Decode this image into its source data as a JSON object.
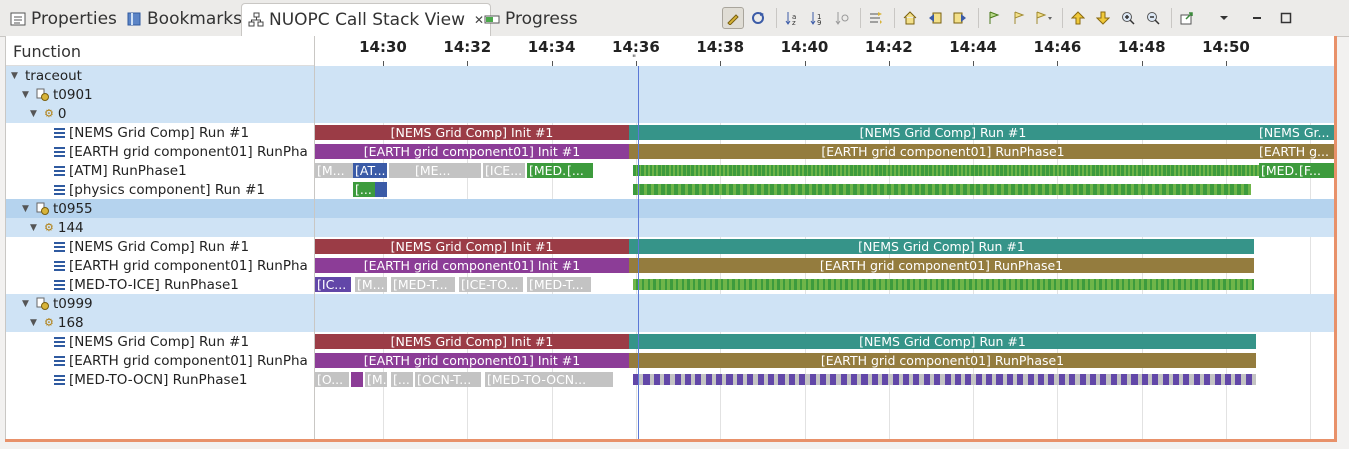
{
  "tabs": [
    {
      "label": "Properties",
      "icon": "properties-icon"
    },
    {
      "label": "Bookmarks",
      "icon": "bookmarks-icon"
    },
    {
      "label": "NUOPC Call Stack View",
      "icon": "call-stack-icon",
      "active": true,
      "closable": true
    },
    {
      "label": "Progress",
      "icon": "progress-icon"
    }
  ],
  "toolbar": [
    "pin-icon",
    "synchronize-icon",
    "sort-alpha-icon",
    "sort-numeric-icon",
    "sort-time-icon",
    "show-legend-icon",
    "home-icon",
    "previous-event-icon",
    "next-event-icon",
    "previous-marker-icon",
    "next-marker-icon",
    "marker-dropdown-icon",
    "previous-item-icon",
    "next-item-icon",
    "zoom-in-icon",
    "zoom-out-icon",
    "view-menu-icon",
    "minimize-icon",
    "maximize-icon"
  ],
  "tree": {
    "header": "Function",
    "rows": [
      {
        "label": "traceout",
        "type": "root",
        "hl": true
      },
      {
        "label": "t0901",
        "type": "thread",
        "hl": true
      },
      {
        "label": "0",
        "type": "pet",
        "hl": true
      },
      {
        "label": "[NEMS Grid Comp] Run #1",
        "type": "fn"
      },
      {
        "label": "[EARTH grid component01] RunPha",
        "type": "fn"
      },
      {
        "label": "[ATM] RunPhase1",
        "type": "fn"
      },
      {
        "label": "[physics component] Run #1",
        "type": "fn"
      },
      {
        "label": "t0955",
        "type": "thread",
        "hl": true,
        "sel": true
      },
      {
        "label": "144",
        "type": "pet",
        "hl": true
      },
      {
        "label": "[NEMS Grid Comp] Run #1",
        "type": "fn"
      },
      {
        "label": "[EARTH grid component01] RunPha",
        "type": "fn"
      },
      {
        "label": "[MED-TO-ICE] RunPhase1",
        "type": "fn"
      },
      {
        "label": "t0999",
        "type": "thread",
        "hl": true
      },
      {
        "label": "168",
        "type": "pet",
        "hl": true
      },
      {
        "label": "[NEMS Grid Comp] Run #1",
        "type": "fn"
      },
      {
        "label": "[EARTH grid component01] RunPha",
        "type": "fn"
      },
      {
        "label": "[MED-TO-OCN] RunPhase1",
        "type": "fn"
      }
    ]
  },
  "time_axis": {
    "ticks": [
      "14:30",
      "14:32",
      "14:34",
      "14:36",
      "14:38",
      "14:40",
      "14:42",
      "14:44",
      "14:46",
      "14:48",
      "14:50"
    ],
    "cursor_marker": "\""
  },
  "colors": {
    "nems_init": "#9b3c46",
    "nems_run": "#369489",
    "earth_init": "#8c3d97",
    "earth_run": "#947c3e",
    "green": "#3d9b3d",
    "blue": "#3b5ba7",
    "gray": "#c3c3c3",
    "purple": "#6247a8",
    "lightgreen": "#6fb549",
    "highlight": "#cfe3f5"
  },
  "tracks": {
    "3": [
      {
        "s": 0,
        "e": 314,
        "c": "nems_init",
        "t": "[NEMS Grid Comp] Init #1"
      },
      {
        "s": 314,
        "e": 942,
        "c": "nems_run",
        "t": "[NEMS Grid Comp] Run #1"
      },
      {
        "s": 942,
        "e": 1021,
        "c": "nems_run",
        "t": "[NEMS Gr...",
        "l": 1
      }
    ],
    "4": [
      {
        "s": 0,
        "e": 314,
        "c": "earth_init",
        "t": "[EARTH grid component01] Init #1"
      },
      {
        "s": 314,
        "e": 942,
        "c": "earth_run",
        "t": "[EARTH grid component01] RunPhase1"
      },
      {
        "s": 942,
        "e": 1021,
        "c": "earth_run",
        "t": "[EARTH g...",
        "l": 1
      }
    ],
    "5": [
      {
        "s": 0,
        "e": 38,
        "c": "gray",
        "t": "[M...",
        "l": 1
      },
      {
        "s": 38,
        "e": 72,
        "c": "blue",
        "t": "[AT...",
        "l": 1
      },
      {
        "s": 74,
        "e": 98,
        "c": "gray",
        "t": ""
      },
      {
        "s": 98,
        "e": 140,
        "c": "gray",
        "t": "[ME...",
        "l": 1
      },
      {
        "s": 140,
        "e": 166,
        "c": "gray",
        "t": ""
      },
      {
        "s": 168,
        "e": 210,
        "c": "gray",
        "t": "[ICE...",
        "l": 1
      },
      {
        "s": 212,
        "e": 250,
        "c": "green",
        "t": "[MED...",
        "l": 1
      },
      {
        "s": 250,
        "e": 278,
        "c": "green",
        "t": "[...",
        "l": 1
      },
      {
        "s": 944,
        "e": 982,
        "c": "green",
        "t": "[MED...",
        "l": 1
      },
      {
        "s": 982,
        "e": 1021,
        "c": "green",
        "t": "[F...",
        "l": 1
      }
    ],
    "6": [
      {
        "s": 38,
        "e": 60,
        "c": "green",
        "t": "[...",
        "l": 1
      },
      {
        "s": 60,
        "e": 72,
        "c": "blue",
        "t": ""
      }
    ],
    "9": [
      {
        "s": 0,
        "e": 314,
        "c": "nems_init",
        "t": "[NEMS Grid Comp] Init #1"
      },
      {
        "s": 314,
        "e": 939,
        "c": "nems_run",
        "t": "[NEMS Grid Comp] Run #1"
      }
    ],
    "10": [
      {
        "s": 0,
        "e": 314,
        "c": "earth_init",
        "t": "[EARTH grid component01] Init #1"
      },
      {
        "s": 314,
        "e": 939,
        "c": "earth_run",
        "t": "[EARTH grid component01] RunPhase1"
      }
    ],
    "11": [
      {
        "s": 0,
        "e": 36,
        "c": "purple",
        "t": "[IC...",
        "l": 1
      },
      {
        "s": 40,
        "e": 72,
        "c": "gray",
        "t": "[M...",
        "l": 1
      },
      {
        "s": 76,
        "e": 140,
        "c": "gray",
        "t": "[MED-T...",
        "l": 1
      },
      {
        "s": 144,
        "e": 208,
        "c": "gray",
        "t": "[ICE-TO...",
        "l": 1
      },
      {
        "s": 212,
        "e": 276,
        "c": "gray",
        "t": "[MED-T...",
        "l": 1
      }
    ],
    "14": [
      {
        "s": 0,
        "e": 314,
        "c": "nems_init",
        "t": "[NEMS Grid Comp] Init #1"
      },
      {
        "s": 314,
        "e": 941,
        "c": "nems_run",
        "t": "[NEMS Grid Comp] Run #1"
      }
    ],
    "15": [
      {
        "s": 0,
        "e": 314,
        "c": "earth_init",
        "t": "[EARTH grid component01] Init #1"
      },
      {
        "s": 314,
        "e": 941,
        "c": "earth_run",
        "t": "[EARTH grid component01] RunPhase1"
      }
    ],
    "16": [
      {
        "s": 0,
        "e": 34,
        "c": "gray",
        "t": "[O...",
        "l": 1
      },
      {
        "s": 36,
        "e": 48,
        "c": "earth_init",
        "t": ""
      },
      {
        "s": 50,
        "e": 72,
        "c": "gray",
        "t": "[M...",
        "l": 1
      },
      {
        "s": 76,
        "e": 98,
        "c": "gray",
        "t": "[...",
        "l": 1
      },
      {
        "s": 100,
        "e": 166,
        "c": "gray",
        "t": "[OCN-T...",
        "l": 1
      },
      {
        "s": 170,
        "e": 298,
        "c": "gray",
        "t": "[MED-TO-OCN...",
        "l": 1
      }
    ]
  },
  "dense": {
    "5": {
      "s": 318,
      "e": 944,
      "c": "green",
      "alt": "lightgreen",
      "n": 150
    },
    "6": {
      "s": 318,
      "e": 936,
      "c": "green",
      "alt": "lightgreen",
      "n": 90
    },
    "11": {
      "s": 318,
      "e": 939,
      "c": "lightgreen",
      "alt": "green",
      "n": 110
    },
    "16": {
      "s": 318,
      "e": 941,
      "c": "purple",
      "alt": "gray",
      "n": 60
    }
  }
}
